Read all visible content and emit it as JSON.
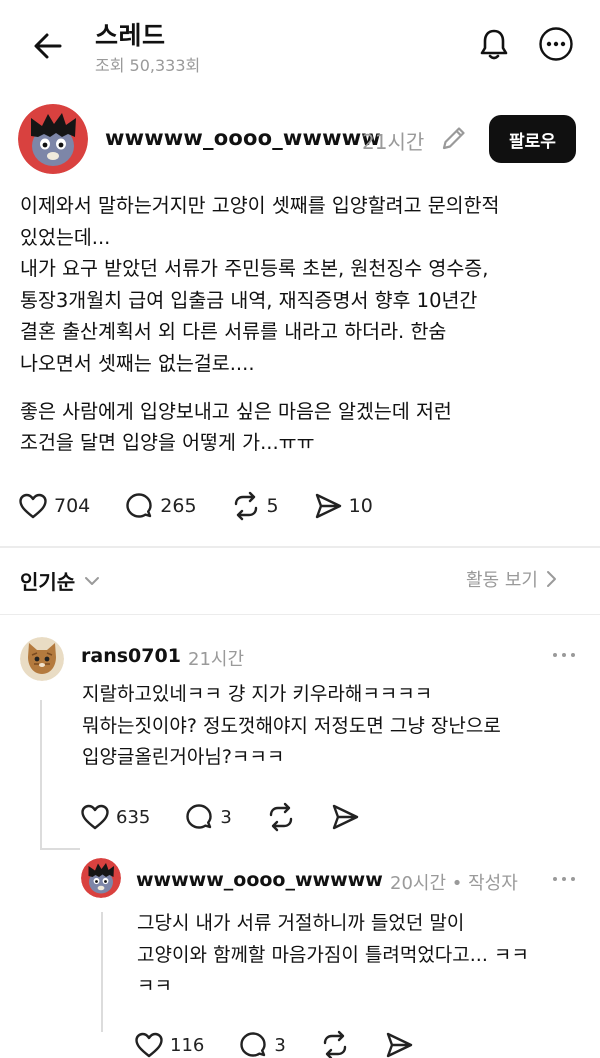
{
  "header": {
    "title": "스레드",
    "views": "조회 50,333회",
    "back_icon": "arrow-left-icon",
    "bell_icon": "bell-icon",
    "more_icon": "more-horizontal-icon"
  },
  "post": {
    "author": "wwwww_oooo_wwwww",
    "time": "21시간",
    "follow_label": "팔로우",
    "lines": [
      "이제와서 말하는거지만 고양이 셋째를 입양할려고 문의한적",
      "있었는데...",
      "내가 요구 받았던 서류가 주민등록 초본, 원천징수 영수증,",
      "통장3개월치 급여 입출금 내역, 재직증명서 향후 10년간",
      "결혼 출산계획서 외 다른 서류를 내라고 하더라. 한숨",
      "나오면서 셋째는 없는걸로...."
    ],
    "lines2": [
      "좋은 사람에게 입양보내고 싶은 마음은 알겠는데 저런",
      "조건을 달면 입양을 어떻게 가...ㅠㅠ"
    ],
    "likes": "704",
    "comments": "265",
    "reposts": "5",
    "shares": "10"
  },
  "sort": {
    "label": "인기순",
    "activity": "활동 보기"
  },
  "comments": [
    {
      "author": "rans0701",
      "time": "21시간",
      "lines": [
        "지랄하고있네ㅋㅋ 걍 지가 키우라해ㅋㅋㅋㅋ",
        "뭐하는짓이야? 정도껏해야지 저정도면 그냥 장난으로",
        "입양글올린거아님?ㅋㅋㅋ"
      ],
      "likes": "635",
      "replies": "3"
    },
    {
      "author": "wwwww_oooo_wwwww",
      "time": "20시간 • 작성자",
      "lines": [
        "그당시 내가 서류 거절하니까 들었던 말이",
        "고양이와 함께할 마음가짐이 틀려먹었다고... ㅋㅋ",
        "ㅋㅋ"
      ],
      "likes": "116",
      "replies": "3"
    }
  ],
  "colors": {
    "text": "#111111",
    "muted": "#9a9a9a",
    "button": "#101010",
    "divider": "#ececec"
  }
}
